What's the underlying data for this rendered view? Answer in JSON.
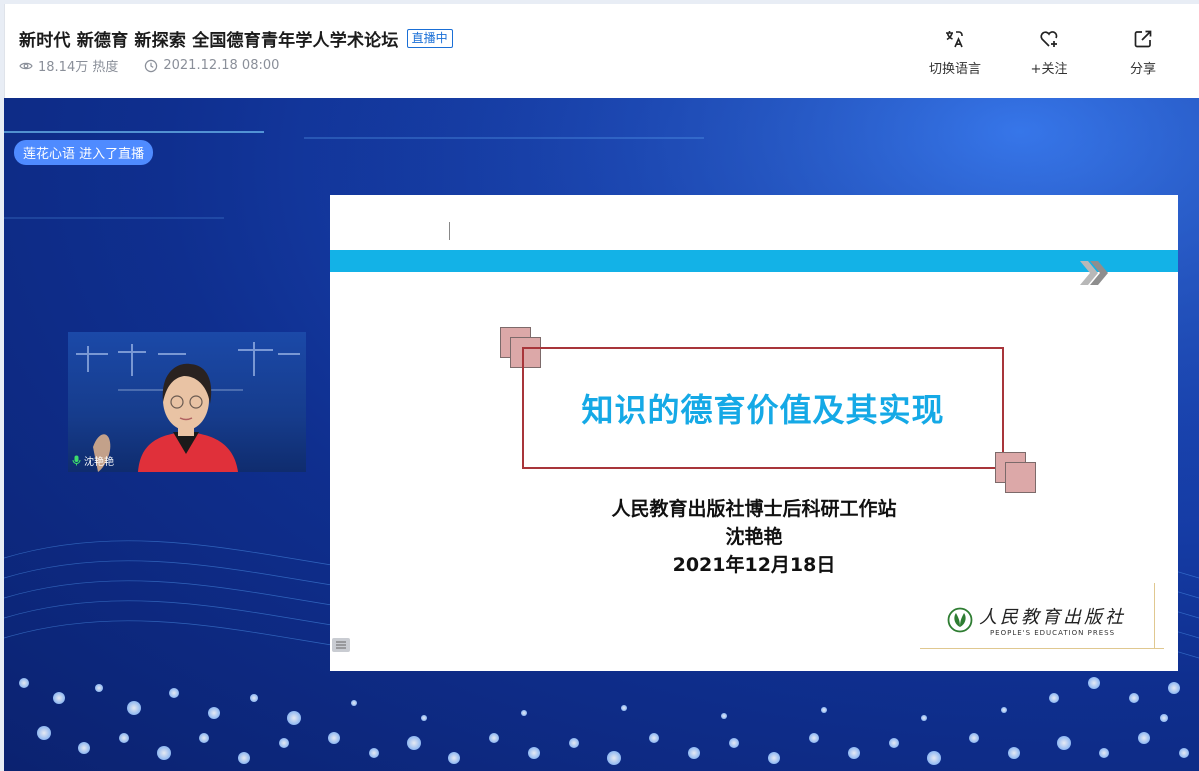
{
  "header": {
    "title": "新时代 新德育 新探索 全国德育青年学人学术论坛",
    "live_badge": "直播中",
    "views": "18.14万 热度",
    "datetime": "2021.12.18 08:00",
    "actions": [
      {
        "label": "切换语言",
        "icon": "translate-icon"
      },
      {
        "label": "+关注",
        "icon": "heart-plus-icon"
      },
      {
        "label": "分享",
        "icon": "share-icon"
      }
    ]
  },
  "stage": {
    "join_toast": "莲花心语 进入了直播",
    "presenter_name": "沈艳艳"
  },
  "slide": {
    "title": "知识的德育价值及其实现",
    "lines": [
      "人民教育出版社博士后科研工作站",
      "沈艳艳",
      "2021年12月18日"
    ],
    "publisher_cn": "人民教育出版社",
    "publisher_en": "PEOPLE'S EDUCATION PRESS"
  },
  "colors": {
    "accent": "#1a6fd6",
    "slide_band": "#13b2e7",
    "slide_title": "#15a9e6",
    "frame": "#a8353a",
    "stage_bg": "#1a46b6"
  }
}
